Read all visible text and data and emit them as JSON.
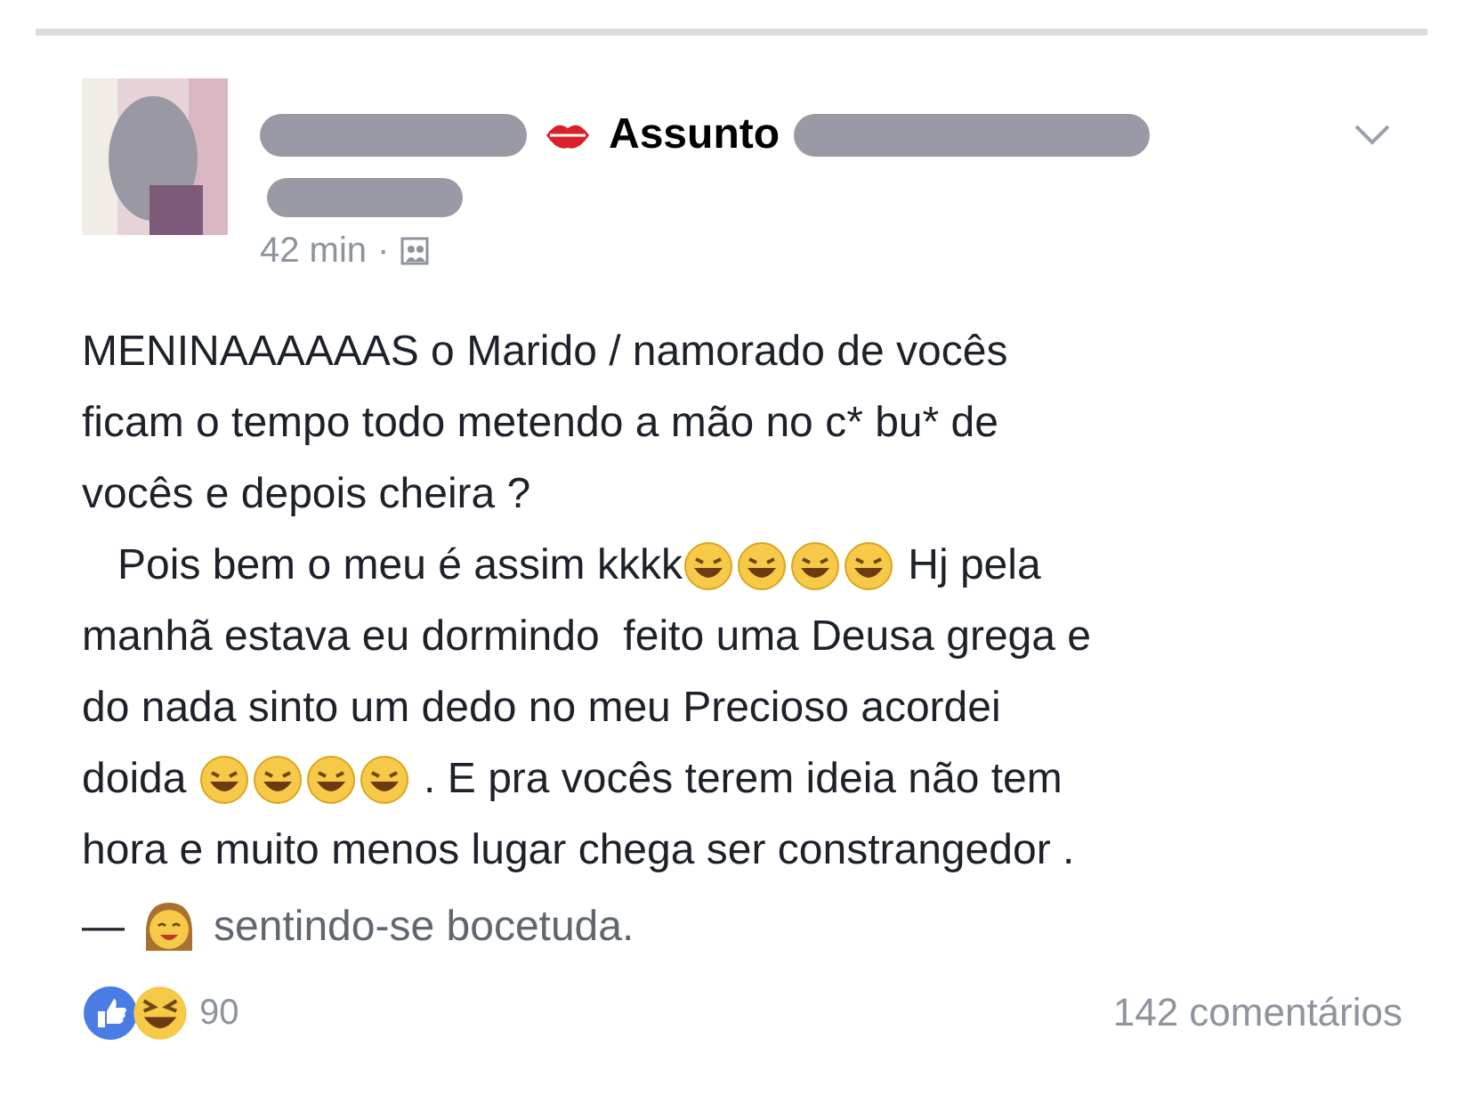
{
  "post": {
    "subject_label": "Assunto",
    "time": "42 min",
    "separator": "·",
    "body": [
      [
        {
          "kind": "text",
          "text": "MENINAAAAAAS o Marido / namorado de vocês"
        }
      ],
      [
        {
          "kind": "text",
          "text": "ficam o tempo todo metendo a mão no c* bu* de"
        }
      ],
      [
        {
          "kind": "text",
          "text": "vocês e depois cheira ?"
        }
      ],
      [
        {
          "kind": "text",
          "text": "   Pois bem o meu é assim kkkk"
        },
        {
          "kind": "laugh"
        },
        {
          "kind": "laugh"
        },
        {
          "kind": "laugh"
        },
        {
          "kind": "laugh"
        },
        {
          "kind": "text",
          "text": " Hj pela"
        }
      ],
      [
        {
          "kind": "text",
          "text": "manhã estava eu dormindo  feito uma Deusa grega e"
        }
      ],
      [
        {
          "kind": "text",
          "text": "do nada sinto um dedo no meu Precioso acordei"
        }
      ],
      [
        {
          "kind": "text",
          "text": "doida "
        },
        {
          "kind": "laugh"
        },
        {
          "kind": "laugh"
        },
        {
          "kind": "laugh"
        },
        {
          "kind": "laugh"
        },
        {
          "kind": "text",
          "text": " . E pra vocês terem ideia não tem"
        }
      ],
      [
        {
          "kind": "text",
          "text": "hora e muito menos lugar chega ser constrangedor ."
        }
      ]
    ],
    "feeling": {
      "dash": "—",
      "text": "sentindo-se bocetuda."
    },
    "reactions": {
      "count": "90"
    },
    "comments": "142 comentários"
  }
}
